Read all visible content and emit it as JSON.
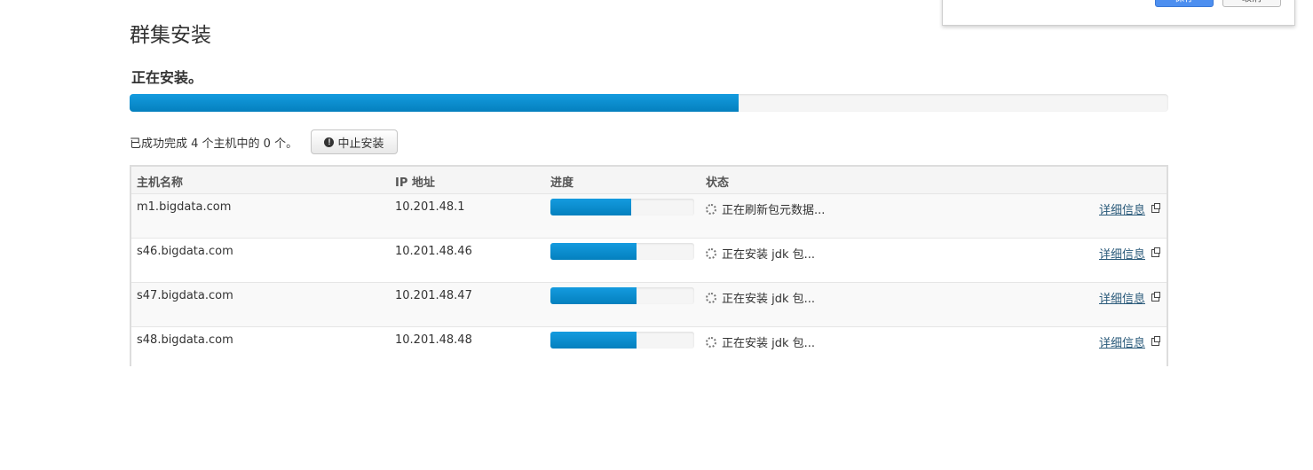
{
  "popup": {
    "save_label": "保存",
    "cancel_label": "取消"
  },
  "page": {
    "title": "群集安装",
    "status": "正在安装。",
    "overall_progress": 0.586,
    "summary": "已成功完成 4 个主机中的 0 个。",
    "abort_label": "中止安装"
  },
  "table": {
    "headers": {
      "hostname": "主机名称",
      "ip": "IP 地址",
      "progress": "进度",
      "status": "状态"
    },
    "rows": [
      {
        "hostname": "m1.bigdata.com",
        "ip": "10.201.48.1",
        "progress": 0.56,
        "status": "正在刷新包元数据...",
        "details": "详细信息"
      },
      {
        "hostname": "s46.bigdata.com",
        "ip": "10.201.48.46",
        "progress": 0.6,
        "status": "正在安装 jdk 包...",
        "details": "详细信息"
      },
      {
        "hostname": "s47.bigdata.com",
        "ip": "10.201.48.47",
        "progress": 0.6,
        "status": "正在安装 jdk 包...",
        "details": "详细信息"
      },
      {
        "hostname": "s48.bigdata.com",
        "ip": "10.201.48.48",
        "progress": 0.6,
        "status": "正在安装 jdk 包...",
        "details": "详细信息"
      }
    ]
  },
  "colors": {
    "progress_fill": "#0e8fd2",
    "link": "#2a5a7a"
  }
}
